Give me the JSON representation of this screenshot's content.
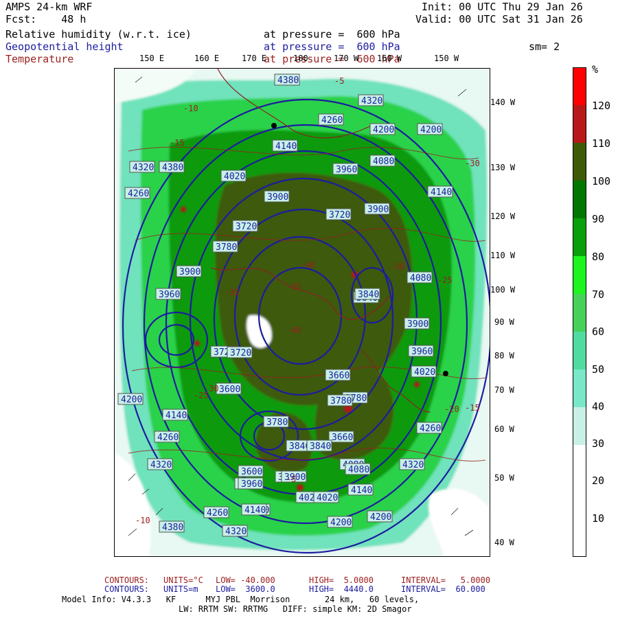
{
  "header": {
    "model": "AMPS 24-km WRF",
    "forecast": "Fcst:    48 h",
    "init": "Init: 00 UTC Thu 29 Jan 26",
    "valid": "Valid: 00 UTC Sat 31 Jan 26",
    "fields": [
      {
        "name": "Relative humidity (w.r.t. ice)",
        "level": "at pressure =  600 hPa",
        "color": "#000000"
      },
      {
        "name": "Geopotential height",
        "level": "at pressure =  600 hPa",
        "color": "#1c1ca0"
      },
      {
        "name": "Temperature",
        "level": "at pressure =  600 hPa",
        "color": "#9b1e1e"
      }
    ],
    "smoothing": "sm= 2"
  },
  "map": {
    "top_longitudes": [
      "150 E",
      "160 E",
      "170 E",
      "180",
      "170 W",
      "160 W",
      "150 W"
    ],
    "right_longitudes": [
      "140 W",
      "130 W",
      "120 W",
      "110 W",
      "100 W",
      "90 W",
      "80 W",
      "70 W",
      "60 W",
      "50 W",
      "40 W"
    ],
    "height_labels": [
      "4380",
      "4320",
      "4260",
      "4200",
      "4140",
      "4080",
      "4020",
      "3960",
      "3900",
      "3840",
      "3780",
      "3720",
      "4380",
      "4320",
      "4320",
      "4260",
      "4260",
      "4200",
      "4200",
      "4140",
      "4140",
      "4140",
      "4080",
      "4020",
      "3960",
      "3960",
      "3900",
      "3900",
      "3900",
      "3840",
      "3780",
      "3780",
      "3720",
      "3720",
      "3660",
      "3600",
      "3900",
      "3960",
      "4020",
      "4080",
      "4140",
      "4200",
      "4260",
      "4320",
      "4380",
      "4320",
      "4260",
      "4200",
      "4140",
      "4080",
      "3840",
      "3660",
      "3600",
      "3720",
      "3780",
      "3840",
      "3900",
      "3960",
      "4020"
    ],
    "temp_labels": [
      "-5",
      "-10",
      "-15",
      "-20",
      "-25",
      "-30",
      "-35",
      "-40",
      "-40",
      "-35",
      "-30",
      "-25",
      "-20",
      "-15",
      "-10",
      "-5"
    ],
    "colors": {
      "height_contour": "#1c1ca0",
      "temp_contour": "#9b1e1e",
      "coast": "#8b2222"
    }
  },
  "colorbar": {
    "unit": "%",
    "ticks": [
      "120",
      "110",
      "100",
      "90",
      "80",
      "70",
      "60",
      "50",
      "40",
      "30",
      "20",
      "10"
    ],
    "colors": [
      "#ffffff",
      "#ffffff",
      "#ffffff",
      "#c8f0e6",
      "#78e8c8",
      "#50dca0",
      "#46d25a",
      "#1ef51e",
      "#0aa00a",
      "#007800",
      "#3c5a08",
      "#9b1e1e",
      "#ff0000"
    ]
  },
  "footer": {
    "temp": {
      "label": "CONTOURS:",
      "units": "UNITS=°C",
      "low": "LOW= -40.000",
      "high": "HIGH=  5.0000",
      "interval": "INTERVAL=   5.0000"
    },
    "height": {
      "label": "CONTOURS:",
      "units": "UNITS=m",
      "low": "LOW=  3600.0",
      "high": "HIGH=  4440.0",
      "interval": "INTERVAL=  60.000"
    },
    "model_info_1": "Model Info: V4.3.3   KF      MYJ PBL  Morrison       24 km,   60 levels,",
    "model_info_2": "LW: RRTM SW: RRTMG   DIFF: simple KM: 2D Smagor"
  }
}
